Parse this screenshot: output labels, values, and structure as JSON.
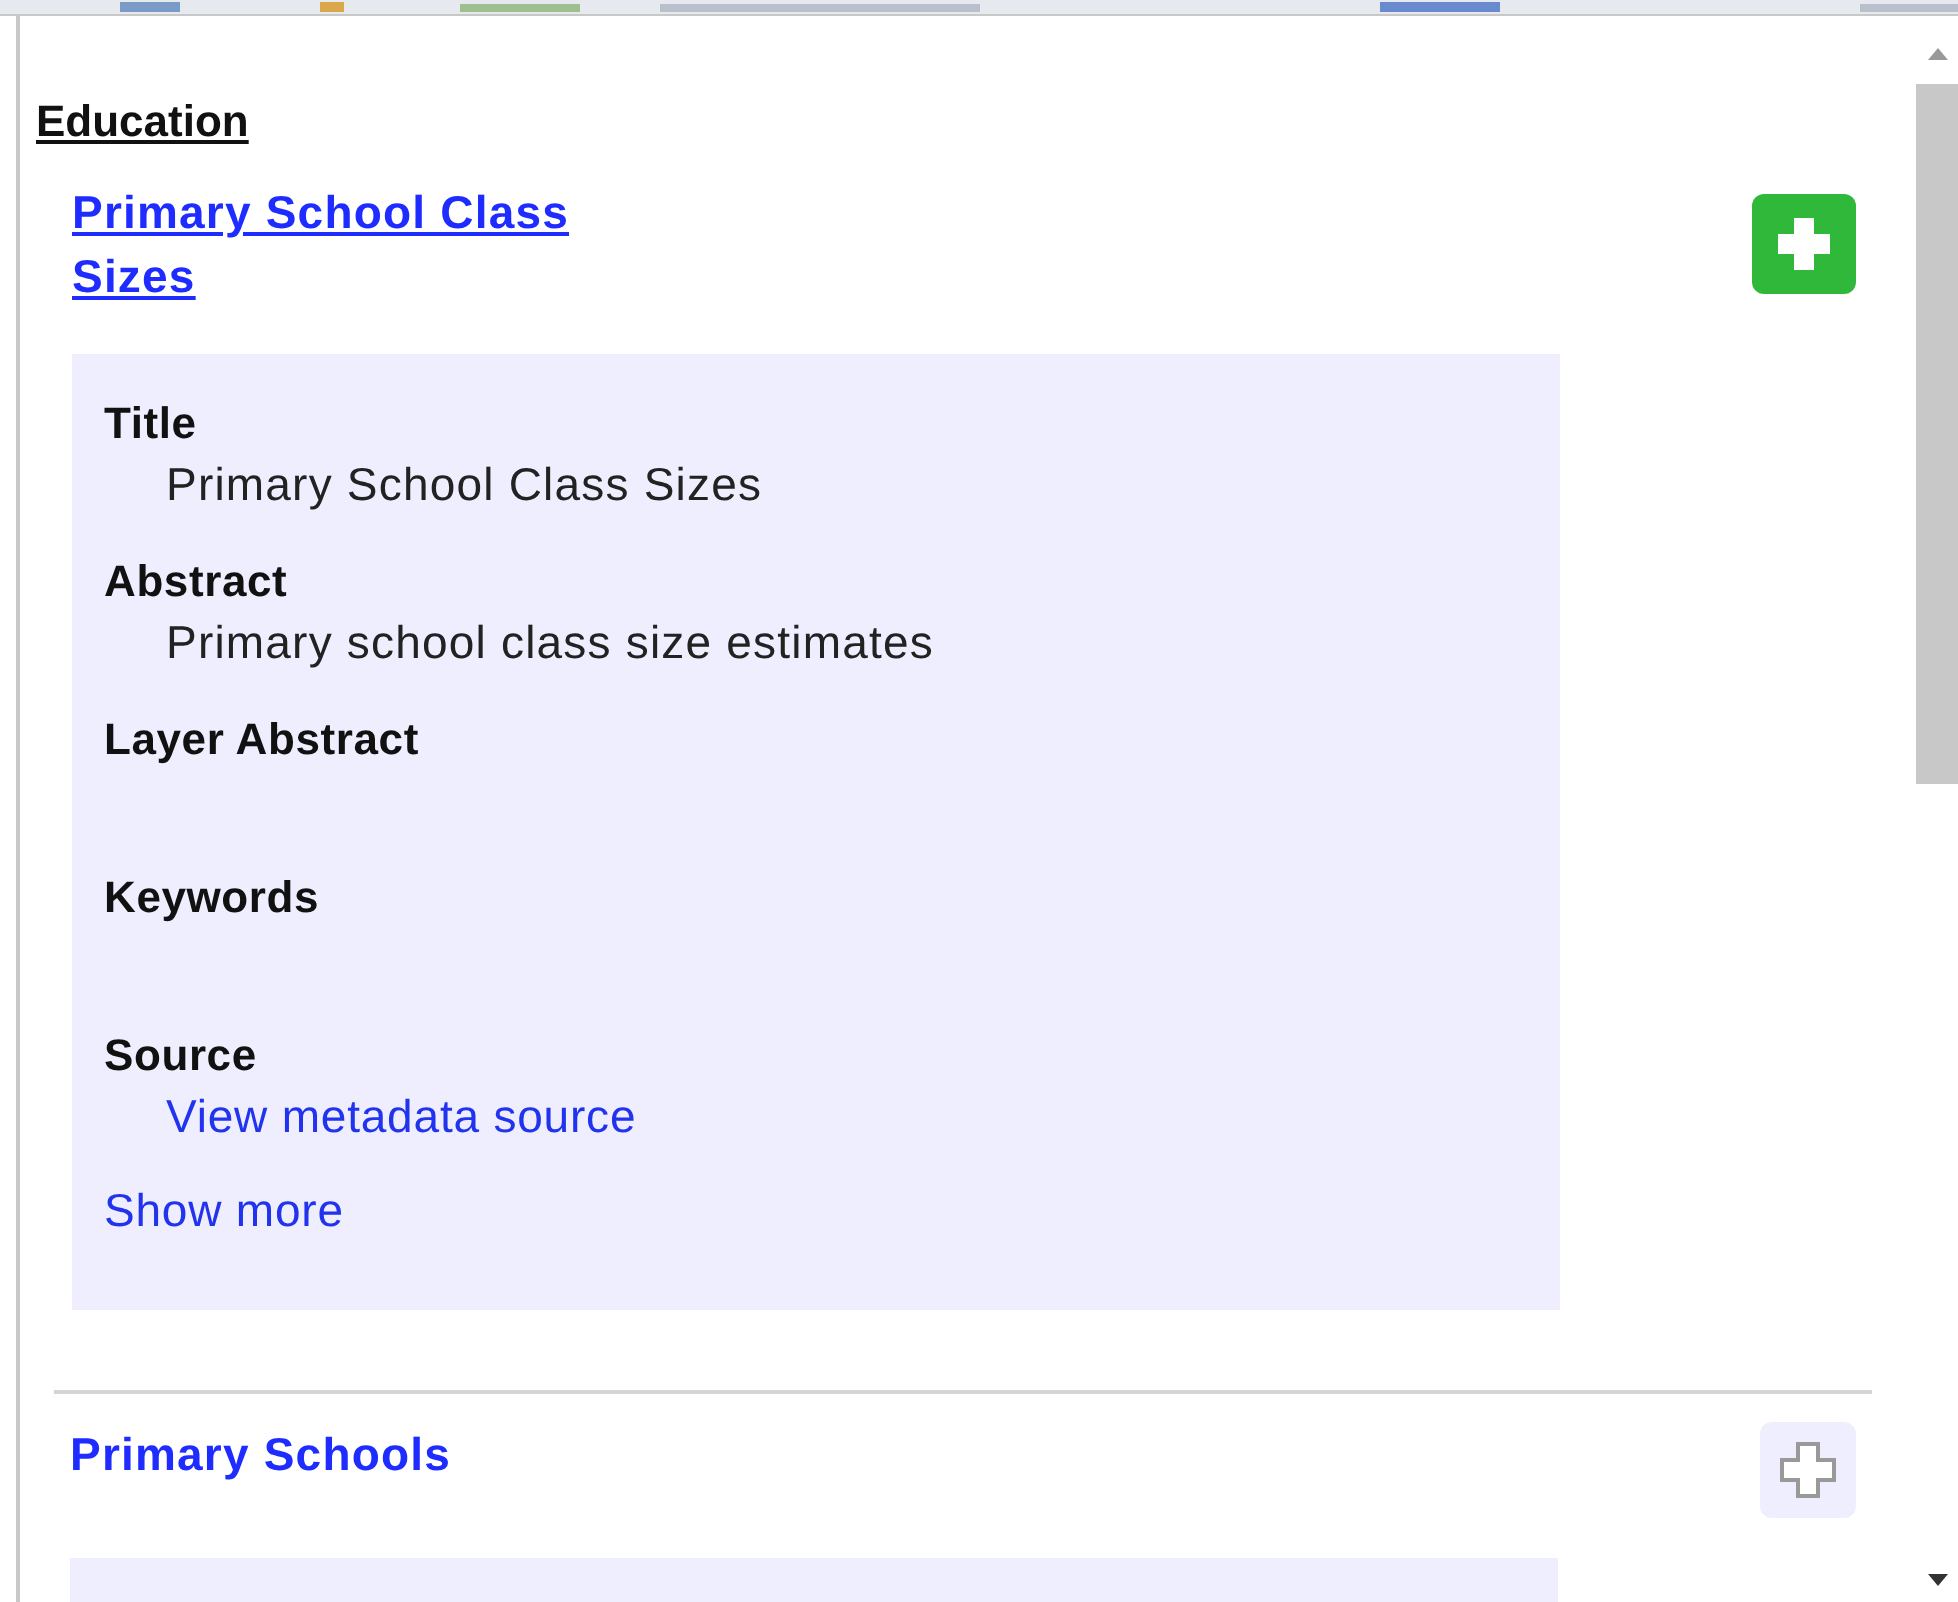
{
  "section": {
    "heading": "Education"
  },
  "layers": [
    {
      "title": "Primary School Class Sizes",
      "selected": true,
      "added": true,
      "expanded": true,
      "fields": [
        {
          "label": "Title",
          "value": "Primary School Class Sizes",
          "kind": "text"
        },
        {
          "label": "Abstract",
          "value": "Primary school class size estimates",
          "kind": "text"
        },
        {
          "label": "Layer Abstract",
          "kind": "text"
        },
        {
          "label": "Keywords",
          "kind": "text"
        },
        {
          "label": "Source",
          "value": "View metadata source",
          "kind": "link"
        }
      ],
      "more_link": "Show more"
    },
    {
      "title": "Primary Schools",
      "selected": false,
      "added": false,
      "expanded": true
    }
  ]
}
